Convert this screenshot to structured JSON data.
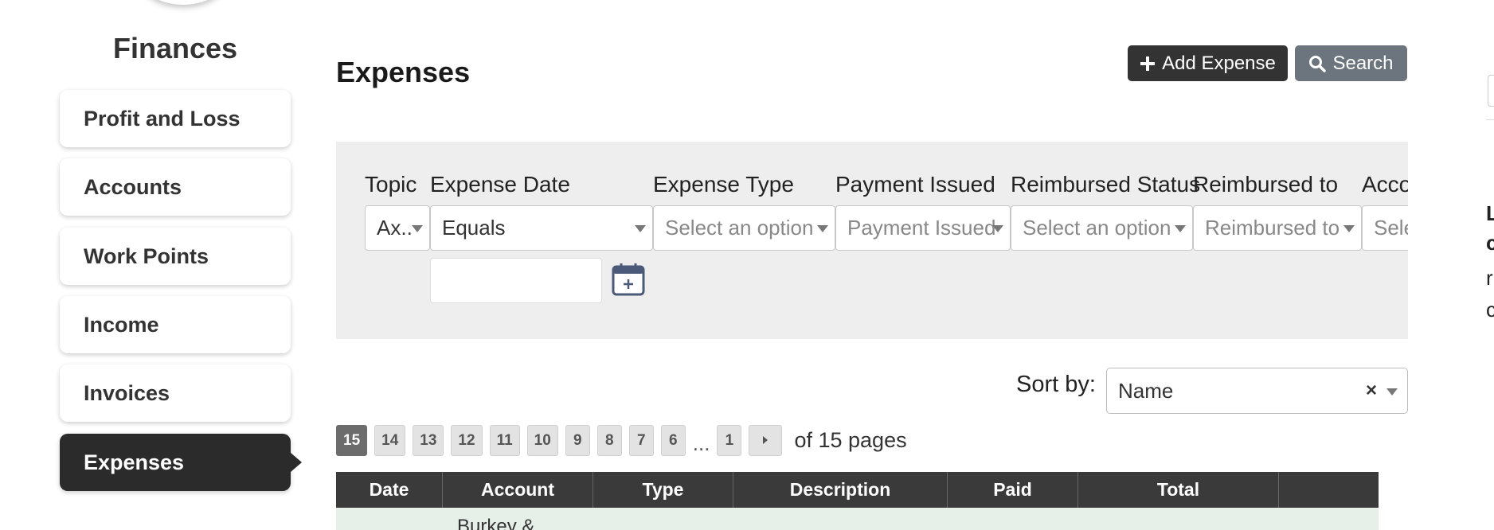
{
  "sidebar": {
    "title": "Finances",
    "items": [
      {
        "label": "Profit and Loss"
      },
      {
        "label": "Accounts"
      },
      {
        "label": "Work Points"
      },
      {
        "label": "Income"
      },
      {
        "label": "Invoices"
      },
      {
        "label": "Expenses",
        "active": true
      }
    ]
  },
  "header": {
    "title": "Expenses",
    "add_label": "Add Expense",
    "search_label": "Search"
  },
  "filters": [
    {
      "label": "Topic",
      "value": "Ax..",
      "placeholder": false
    },
    {
      "label": "Expense Date",
      "value": "Equals",
      "placeholder": false
    },
    {
      "label": "Expense Type",
      "value": "Select an option",
      "placeholder": true
    },
    {
      "label": "Payment Issued",
      "value": "Payment Issued",
      "placeholder": true
    },
    {
      "label": "Reimbursed Status",
      "value": "Select an option",
      "placeholder": true
    },
    {
      "label": "Reimbursed to",
      "value": "Reimbursed to",
      "placeholder": true
    },
    {
      "label": "Account Ba",
      "value": "Select an o",
      "placeholder": true
    }
  ],
  "sort": {
    "label": "Sort by:",
    "value": "Name",
    "clear": "×"
  },
  "pagination": {
    "pages": [
      "15",
      "14",
      "13",
      "12",
      "11",
      "10",
      "9",
      "8",
      "7",
      "6"
    ],
    "current": "15",
    "ellipsis": "...",
    "last": "1",
    "total_text": "of 15 pages"
  },
  "table": {
    "columns": [
      "Date",
      "Account",
      "Type",
      "Description",
      "Paid",
      "Total",
      ""
    ],
    "first_row_account": "Burkey &"
  },
  "edge_glyphs": [
    "L",
    "c",
    "r",
    "c"
  ],
  "colors": {
    "active_nav": "#2b2b2b",
    "add_button": "#333333",
    "search_button": "#6c757d",
    "table_header": "#3a3a3a",
    "row_tint": "#e6efe8",
    "filter_panel": "#eeeeee"
  },
  "icons": {
    "add": "plus-icon",
    "search": "search-icon",
    "calendar": "calendar-plus-icon",
    "next": "chevron-right-icon"
  }
}
